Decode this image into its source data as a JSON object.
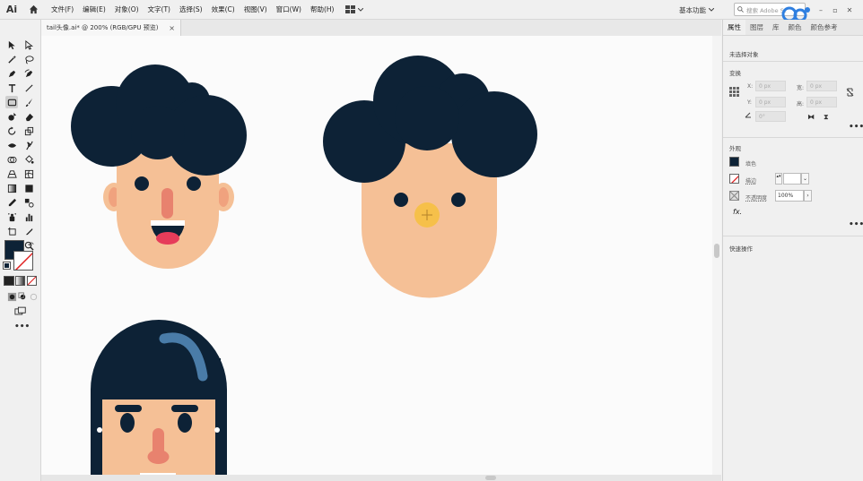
{
  "app": {
    "logo": "Ai",
    "workspace_label": "基本功能",
    "search_placeholder": "搜索 Adobe St"
  },
  "menu": [
    "文件(F)",
    "编辑(E)",
    "对象(O)",
    "文字(T)",
    "选择(S)",
    "效果(C)",
    "视图(V)",
    "窗口(W)",
    "帮助(H)"
  ],
  "document_tab": {
    "title": "tail头像.ai* @ 200% (RGB/GPU 预览)",
    "close": "×"
  },
  "panel": {
    "tabs": [
      "属性",
      "图层",
      "库",
      "颜色",
      "颜色参考"
    ],
    "active_tab": "属性",
    "selection_status": "未选择对象",
    "transform_title": "变换",
    "x_label": "X:",
    "x_value": "0 px",
    "y_label": "Y:",
    "y_value": "0 px",
    "w_label": "宽:",
    "w_value": "0 px",
    "h_label": "高:",
    "h_value": "0 px",
    "angle_value": "0°",
    "appearance_title": "外观",
    "fill_label": "填色",
    "stroke_label": "描边",
    "opacity_label": "不透明度",
    "opacity_value": "100%",
    "fx_label": "fx.",
    "quick_actions_title": "快速操作",
    "more_glyph": "•••"
  },
  "colors": {
    "hair": "#0d2236",
    "skin": "#f5c096",
    "ear": "#f0a27e",
    "nose": "#e8826e",
    "mouth": "#0d2236",
    "tongue": "#e63c5a",
    "teeth": "#ffffff",
    "beak": "#f6c04a",
    "highlight": "#4a7ca8",
    "fill_swatch": "#0d2236"
  },
  "toolbar": {
    "more_glyph": "•••"
  }
}
